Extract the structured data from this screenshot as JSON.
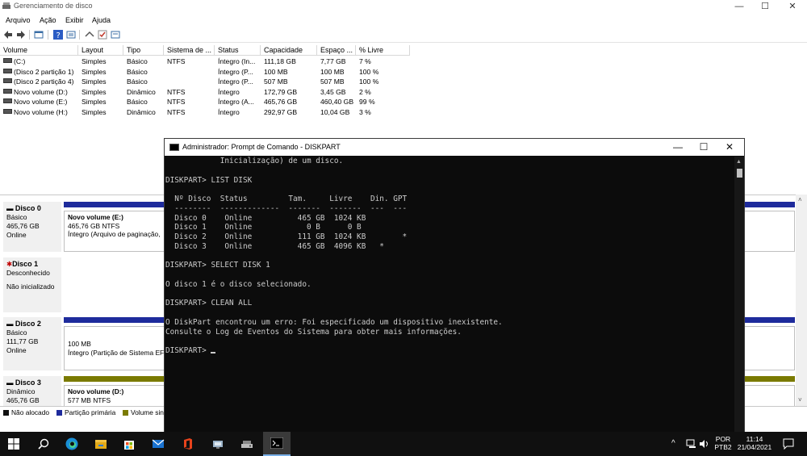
{
  "window": {
    "title": "Gerenciamento de disco",
    "controls": {
      "minimize": "—",
      "maximize": "☐",
      "close": "✕"
    }
  },
  "menu": [
    "Arquivo",
    "Ação",
    "Exibir",
    "Ajuda"
  ],
  "volume_list": {
    "columns": [
      "Volume",
      "Layout",
      "Tipo",
      "Sistema de ...",
      "Status",
      "Capacidade",
      "Espaço ...",
      "% Livre"
    ],
    "rows": [
      [
        "(C:)",
        "Simples",
        "Básico",
        "NTFS",
        "Íntegro (In...",
        "111,18 GB",
        "7,77 GB",
        "7 %"
      ],
      [
        "(Disco 2 partição 1)",
        "Simples",
        "Básico",
        "",
        "Íntegro (P...",
        "100 MB",
        "100 MB",
        "100 %"
      ],
      [
        "(Disco 2 partição 4)",
        "Simples",
        "Básico",
        "",
        "Íntegro (P...",
        "507 MB",
        "507 MB",
        "100 %"
      ],
      [
        "Novo volume (D:)",
        "Simples",
        "Dinâmico",
        "NTFS",
        "Íntegro",
        "172,79 GB",
        "3,45 GB",
        "2 %"
      ],
      [
        "Novo volume (E:)",
        "Simples",
        "Básico",
        "NTFS",
        "Íntegro (A...",
        "465,76 GB",
        "460,40 GB",
        "99 %"
      ],
      [
        "Novo volume (H:)",
        "Simples",
        "Dinâmico",
        "NTFS",
        "Íntegro",
        "292,97 GB",
        "10,04 GB",
        "3 %"
      ]
    ]
  },
  "disks": [
    {
      "name": "Disco 0",
      "lines": [
        "Básico",
        "465,76 GB",
        "Online"
      ],
      "partition": {
        "title": "Novo volume  (E:)",
        "size": "465,76 GB NTFS",
        "status": "Íntegro (Arquivo de paginação,"
      }
    },
    {
      "name": "Disco 1",
      "lines": [
        "Desconhecido",
        "",
        "Não inicializado"
      ]
    },
    {
      "name": "Disco 2",
      "lines": [
        "Básico",
        "111,77 GB",
        "Online"
      ],
      "partition": {
        "title": "",
        "size": "100 MB",
        "status": "Íntegro (Partição de Sistema EF"
      }
    },
    {
      "name": "Disco 3",
      "lines": [
        "Dinâmico",
        "465,76 GB"
      ],
      "partition": {
        "title": "Novo volume  (D:)",
        "size": "577 MB NTFS",
        "status": ""
      }
    }
  ],
  "legend": [
    {
      "label": "Não alocado",
      "color": "#111111"
    },
    {
      "label": "Partição primária",
      "color": "#1e2b9c"
    },
    {
      "label": "Volume sin",
      "color": "#7a7a00"
    }
  ],
  "cmd": {
    "title": "Administrador: Prompt de Comando - DISKPART",
    "lines": [
      "            Inicialização) de um disco.",
      "",
      "DISKPART> LIST DISK",
      "",
      "  Nº Disco  Status         Tam.     Livre    Din. GPT",
      "  --------  -------------  -------  -------  ---  ---",
      "  Disco 0    Online          465 GB  1024 KB",
      "  Disco 1    Online            0 B      0 B",
      "  Disco 2    Online          111 GB  1024 KB        *",
      "  Disco 3    Online          465 GB  4096 KB   *",
      "",
      "DISKPART> SELECT DISK 1",
      "",
      "O disco 1 é o disco selecionado.",
      "",
      "DISKPART> CLEAN ALL",
      "",
      "O DiskPart encontrou um erro: Foi especificado um dispositivo inexistente.",
      "Consulte o Log de Eventos do Sistema para obter mais informações.",
      ""
    ],
    "prompt": "DISKPART> "
  },
  "taskbar": {
    "lang_top": "POR",
    "lang_bottom": "PTB2",
    "time": "11:14",
    "date": "21/04/2021",
    "tray_caret": "^"
  },
  "colors": {
    "primary_partition": "#1e2b9c",
    "dynamic_volume": "#7a7a00",
    "disk_error": "#c00000"
  }
}
